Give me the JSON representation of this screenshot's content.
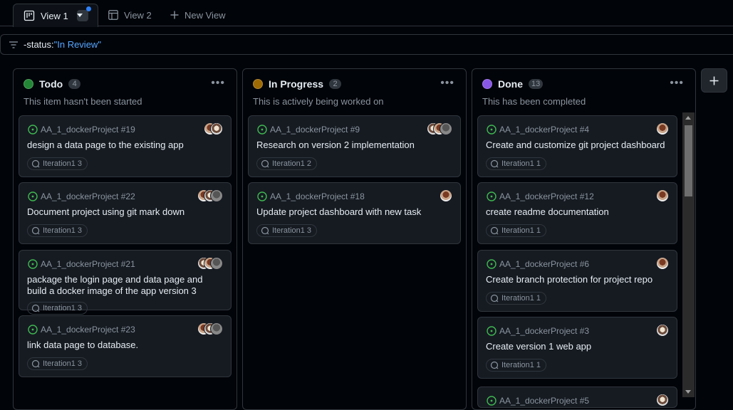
{
  "tabs": [
    {
      "label": "View 1"
    },
    {
      "label": "View 2"
    },
    {
      "label": "New View"
    }
  ],
  "filter": {
    "key": "-status:",
    "value": "\"In Review\""
  },
  "columns": [
    {
      "title": "Todo",
      "count": "4",
      "color": "#238636",
      "description": "This item hasn't been started",
      "cards": [
        {
          "ref": "AA_1_dockerProject #19",
          "title": "design a data page to the existing app",
          "iteration": "Iteration1 3"
        },
        {
          "ref": "AA_1_dockerProject #22",
          "title": "Document project using git mark down",
          "iteration": "Iteration1 3"
        },
        {
          "ref": "AA_1_dockerProject #21",
          "title": "package the login page and data page and build a docker image of the app version 3",
          "iteration": "Iteration1 3"
        },
        {
          "ref": "AA_1_dockerProject #23",
          "title": "link data page to database.",
          "iteration": "Iteration1 3"
        }
      ]
    },
    {
      "title": "In Progress",
      "count": "2",
      "color": "#9e6a03",
      "description": "This is actively being worked on",
      "cards": [
        {
          "ref": "AA_1_dockerProject #9",
          "title": "Research on version 2 implementation",
          "iteration": "Iteration1 2"
        },
        {
          "ref": "AA_1_dockerProject #18",
          "title": "Update project dashboard with new task",
          "iteration": "Iteration1 3"
        }
      ]
    },
    {
      "title": "Done",
      "count": "13",
      "color": "#8957e5",
      "description": "This has been completed",
      "cards": [
        {
          "ref": "AA_1_dockerProject #4",
          "title": "Create and customize git project dashboard",
          "iteration": "Iteration1 1"
        },
        {
          "ref": "AA_1_dockerProject #12",
          "title": "create readme documentation",
          "iteration": "Iteration1 1"
        },
        {
          "ref": "AA_1_dockerProject #6",
          "title": "Create branch protection for project repo",
          "iteration": "Iteration1 1"
        },
        {
          "ref": "AA_1_dockerProject #3",
          "title": "Create version 1 web app",
          "iteration": "Iteration1 1"
        },
        {
          "ref": "AA_1_dockerProject #5",
          "title": "",
          "iteration": ""
        }
      ]
    }
  ],
  "icons": {
    "board": "table-board-icon",
    "table": "table-icon",
    "plus": "plus-icon",
    "filter": "filter-icon",
    "issue": "issue-open-icon",
    "iteration": "iteration-icon",
    "more": "kebab-horizontal-icon"
  }
}
